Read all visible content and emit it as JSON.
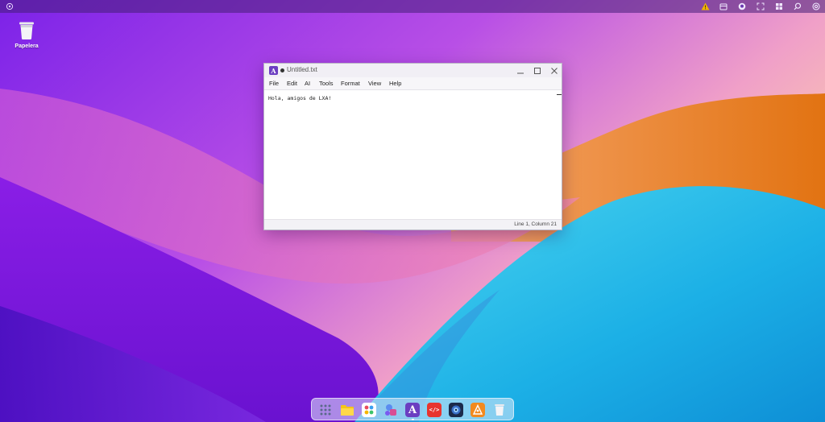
{
  "desktop": {
    "trash_label": "Papelera"
  },
  "window": {
    "title": "Untitled.txt",
    "app_badge": "A",
    "menu": [
      "File",
      "Edit",
      "AI",
      "Tools",
      "Format",
      "View",
      "Help"
    ],
    "content": "Hola, amigos de LXA!",
    "status": "Line 1, Column 21"
  },
  "topbar": {
    "icons": [
      "launcher-icon",
      "warning-icon",
      "package-icon",
      "github-icon",
      "fullscreen-icon",
      "grid-icon",
      "search-icon",
      "power-icon"
    ]
  },
  "dock": {
    "apps": [
      "app-grid-icon",
      "folder-icon",
      "palette-icon",
      "shapes-icon",
      "text-editor-icon",
      "code-icon",
      "browser-icon",
      "vector-icon",
      "trash-icon"
    ],
    "active": "text-editor-icon"
  },
  "colors": {
    "accent": "#6b3ec1",
    "warning": "#f0b400"
  }
}
